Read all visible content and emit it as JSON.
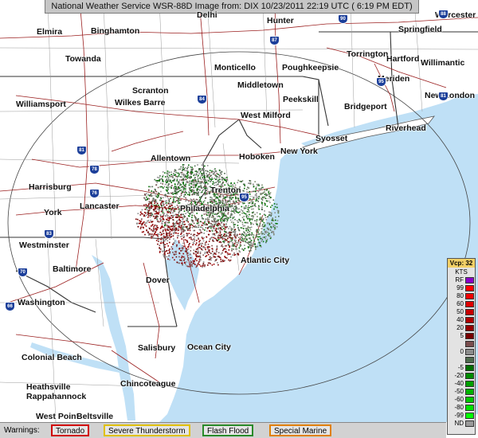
{
  "header": {
    "title": "National Weather Service WSR-88D Image  from: DIX 10/23/2011  22:19 UTC ( 6:19 PM EDT)"
  },
  "cities": [
    {
      "name": "Elmira"
    },
    {
      "name": "Binghamton"
    },
    {
      "name": "Delhi"
    },
    {
      "name": "Hunter"
    },
    {
      "name": "Worcester"
    },
    {
      "name": "Springfield"
    },
    {
      "name": "Towanda"
    },
    {
      "name": "Monticello"
    },
    {
      "name": "Poughkeepsie"
    },
    {
      "name": "Torrington"
    },
    {
      "name": "Hartford"
    },
    {
      "name": "Willimantic"
    },
    {
      "name": "Middletown"
    },
    {
      "name": "Meriden"
    },
    {
      "name": "Scranton"
    },
    {
      "name": "Wilkes Barre"
    },
    {
      "name": "Peekskill"
    },
    {
      "name": "New London"
    },
    {
      "name": "Williamsport"
    },
    {
      "name": "Bridgeport"
    },
    {
      "name": "West Milford"
    },
    {
      "name": "Riverhead"
    },
    {
      "name": "Syosset"
    },
    {
      "name": "Allentown"
    },
    {
      "name": "Hoboken"
    },
    {
      "name": "New York"
    },
    {
      "name": "Harrisburg"
    },
    {
      "name": "Trenton"
    },
    {
      "name": "Lancaster"
    },
    {
      "name": "Philadelphia"
    },
    {
      "name": "York"
    },
    {
      "name": "Westminster"
    },
    {
      "name": "Baltimore"
    },
    {
      "name": "Atlantic City"
    },
    {
      "name": "Dover"
    },
    {
      "name": "Washington"
    },
    {
      "name": "Salisbury"
    },
    {
      "name": "Ocean City"
    },
    {
      "name": "Colonial Beach"
    },
    {
      "name": "Chincoteague"
    },
    {
      "name": "Heathsville"
    },
    {
      "name": "Rappahannock"
    },
    {
      "name": "West Point"
    },
    {
      "name": "Beltsville"
    }
  ],
  "highways": [
    "90",
    "87",
    "84",
    "95",
    "81",
    "78",
    "76",
    "83",
    "70",
    "95",
    "66",
    "81",
    "88"
  ],
  "legend": {
    "title": "Vcp: 32",
    "units": "KTS",
    "rows": [
      {
        "label": "RF",
        "color": "#8a00c8"
      },
      {
        "label": "99",
        "color": "#ff0000"
      },
      {
        "label": "80",
        "color": "#f00000"
      },
      {
        "label": "60",
        "color": "#e00000"
      },
      {
        "label": "50",
        "color": "#c80000"
      },
      {
        "label": "40",
        "color": "#b00000"
      },
      {
        "label": "20",
        "color": "#960000"
      },
      {
        "label": "5",
        "color": "#780000"
      },
      {
        "label": "",
        "color": "#7a4e4e"
      },
      {
        "label": "0",
        "color": "#8c8c8c"
      },
      {
        "label": "",
        "color": "#4e6a4e"
      },
      {
        "label": "-5",
        "color": "#006e00"
      },
      {
        "label": "-20",
        "color": "#008c00"
      },
      {
        "label": "-40",
        "color": "#00a000"
      },
      {
        "label": "-50",
        "color": "#00b400"
      },
      {
        "label": "-60",
        "color": "#00c800"
      },
      {
        "label": "-80",
        "color": "#00e100"
      },
      {
        "label": "-99",
        "color": "#00ff00"
      },
      {
        "label": "ND",
        "color": "#9a9a9a"
      }
    ]
  },
  "warnings": {
    "label": "Warnings:",
    "items": [
      {
        "name": "Tornado",
        "color": "#d00000"
      },
      {
        "name": "Severe Thunderstorm",
        "color": "#e0c000"
      },
      {
        "name": "Flash Flood",
        "color": "#2a8a2a"
      },
      {
        "name": "Special Marine",
        "color": "#e08000"
      }
    ]
  }
}
